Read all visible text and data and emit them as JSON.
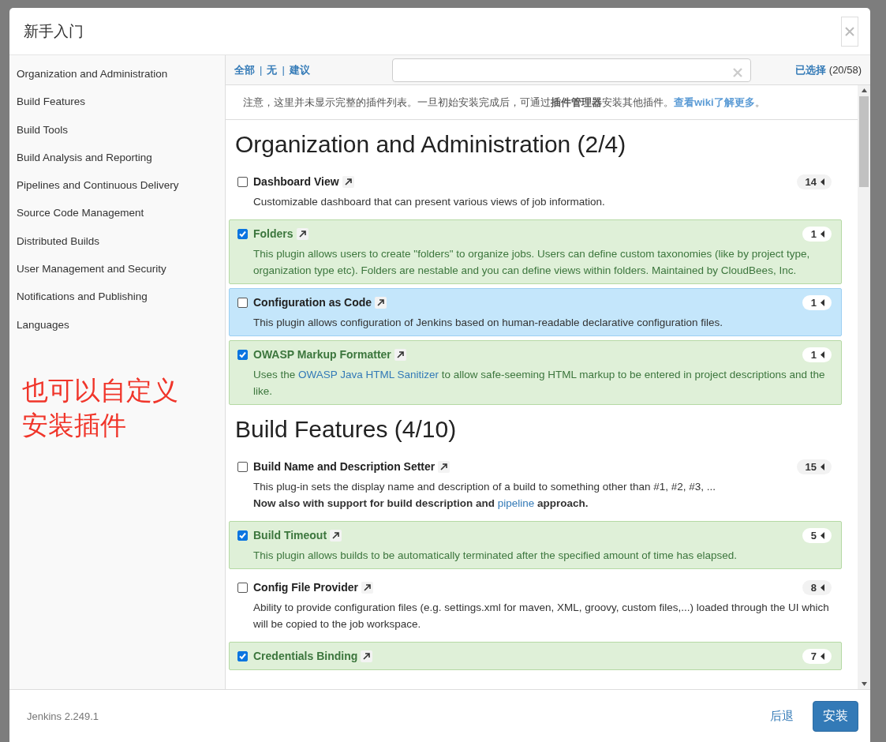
{
  "dialog": {
    "title": "新手入门"
  },
  "sidebar": {
    "items": [
      {
        "label": "Organization and Administration"
      },
      {
        "label": "Build Features"
      },
      {
        "label": "Build Tools"
      },
      {
        "label": "Build Analysis and Reporting"
      },
      {
        "label": "Pipelines and Continuous Delivery"
      },
      {
        "label": "Source Code Management"
      },
      {
        "label": "Distributed Builds"
      },
      {
        "label": "User Management and Security"
      },
      {
        "label": "Notifications and Publishing"
      },
      {
        "label": "Languages"
      }
    ],
    "annotation": "也可以自定义安装插件"
  },
  "toolbar": {
    "filters": [
      "全部",
      "无",
      "建议"
    ],
    "separator": "|",
    "selected_label": "已选择",
    "selected_count": "(20/58)"
  },
  "notice": {
    "parts": [
      {
        "text": "注意，这里并未显示完整的插件列表。一旦初始安装完成后，可通过**插件管理器**安装其他插件。",
        "link": false
      },
      {
        "text": "查看wiki了解更多",
        "link": true
      },
      {
        "text": "。",
        "link": false
      }
    ]
  },
  "sections": [
    {
      "title": "Organization and Administration (2/4)",
      "plugins": [
        {
          "name": "Dashboard View",
          "checked": false,
          "highlighted": false,
          "count": "14",
          "description": [
            {
              "bold": false,
              "parts": [
                {
                  "text": "Customizable dashboard that can present various views of job information.",
                  "link": false
                }
              ]
            }
          ]
        },
        {
          "name": "Folders",
          "checked": true,
          "highlighted": false,
          "count": "1",
          "description": [
            {
              "bold": false,
              "parts": [
                {
                  "text": "This plugin allows users to create \"folders\" to organize jobs. Users can define custom taxonomies (like by project type, organization type etc). Folders are nestable and you can define views within folders. Maintained by CloudBees, Inc.",
                  "link": false
                }
              ]
            }
          ]
        },
        {
          "name": "Configuration as Code",
          "checked": false,
          "highlighted": true,
          "count": "1",
          "description": [
            {
              "bold": false,
              "parts": [
                {
                  "text": "This plugin allows configuration of Jenkins based on human-readable declarative configuration files.",
                  "link": false
                }
              ]
            }
          ]
        },
        {
          "name": "OWASP Markup Formatter",
          "checked": true,
          "highlighted": false,
          "count": "1",
          "description": [
            {
              "bold": false,
              "parts": [
                {
                  "text": "Uses the ",
                  "link": false
                },
                {
                  "text": "OWASP Java HTML Sanitizer",
                  "link": true
                },
                {
                  "text": " to allow safe-seeming HTML markup to be entered in project descriptions and the like.",
                  "link": false
                }
              ]
            }
          ]
        }
      ]
    },
    {
      "title": "Build Features (4/10)",
      "plugins": [
        {
          "name": "Build Name and Description Setter",
          "checked": false,
          "highlighted": false,
          "count": "15",
          "description": [
            {
              "bold": false,
              "parts": [
                {
                  "text": "This plug-in sets the display name and description of a build to something other than #1, #2, #3, ...",
                  "link": false
                }
              ]
            },
            {
              "bold": true,
              "parts": [
                {
                  "text": "Now also with support for build description and ",
                  "link": false
                },
                {
                  "text": "pipeline",
                  "link": true
                },
                {
                  "text": " approach.",
                  "link": false
                }
              ]
            }
          ]
        },
        {
          "name": "Build Timeout",
          "checked": true,
          "highlighted": false,
          "count": "5",
          "description": [
            {
              "bold": false,
              "parts": [
                {
                  "text": "This plugin allows builds to be automatically terminated after the specified amount of time has elapsed.",
                  "link": false
                }
              ]
            }
          ]
        },
        {
          "name": "Config File Provider",
          "checked": false,
          "highlighted": false,
          "count": "8",
          "description": [
            {
              "bold": false,
              "parts": [
                {
                  "text": "Ability to provide configuration files (e.g. settings.xml for maven, XML, groovy, custom files,...) loaded through the UI which will be copied to the job workspace.",
                  "link": false
                }
              ]
            }
          ]
        },
        {
          "name": "Credentials Binding",
          "checked": true,
          "highlighted": false,
          "count": "7"
        }
      ]
    }
  ],
  "footer": {
    "version": "Jenkins 2.249.1",
    "back": "后退",
    "install": "安装"
  }
}
